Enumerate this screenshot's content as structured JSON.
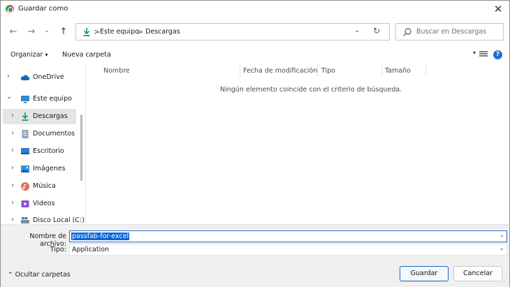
{
  "window": {
    "title": "Guardar como"
  },
  "nav": {
    "back": "←",
    "forward": "→",
    "recent": "⌄",
    "up": "↑"
  },
  "address": {
    "crumbs": [
      "Este equipo",
      "Descargas"
    ],
    "separator": ">"
  },
  "search": {
    "placeholder": "Buscar en Descargas"
  },
  "toolbar": {
    "organize": "Organizar",
    "new_folder": "Nueva carpeta"
  },
  "sidebar": {
    "items": [
      {
        "label": "OneDrive",
        "icon": "cloud-icon",
        "arrow": "›"
      },
      {
        "label": "Este equipo",
        "icon": "computer-icon",
        "arrow": "⌄"
      },
      {
        "label": "Descargas",
        "icon": "download-icon",
        "arrow": "›"
      },
      {
        "label": "Documentos",
        "icon": "document-icon",
        "arrow": "›"
      },
      {
        "label": "Escritorio",
        "icon": "desktop-icon",
        "arrow": "›"
      },
      {
        "label": "Imágenes",
        "icon": "image-icon",
        "arrow": "›"
      },
      {
        "label": "Música",
        "icon": "music-icon",
        "arrow": "›"
      },
      {
        "label": "Videos",
        "icon": "video-icon",
        "arrow": "›"
      },
      {
        "label": "Disco Local (C:)",
        "icon": "drive-icon",
        "arrow": "›"
      }
    ]
  },
  "columns": [
    "Nombre",
    "Fecha de modificación",
    "Tipo",
    "Tamaño"
  ],
  "empty_message": "Ningún elemento coincide con el criterio de búsqueda.",
  "form": {
    "filename_label": "Nombre de archivo:",
    "filename_value": "passfab-for-excel",
    "type_label": "Tipo:",
    "type_value": "Application"
  },
  "footer": {
    "hide_folders": "Ocultar carpetas",
    "save": "Guardar",
    "cancel": "Cancelar"
  },
  "colors": {
    "accent": "#1f6fcf",
    "selection": "#0a64d8",
    "download_green": "#1aa260"
  }
}
